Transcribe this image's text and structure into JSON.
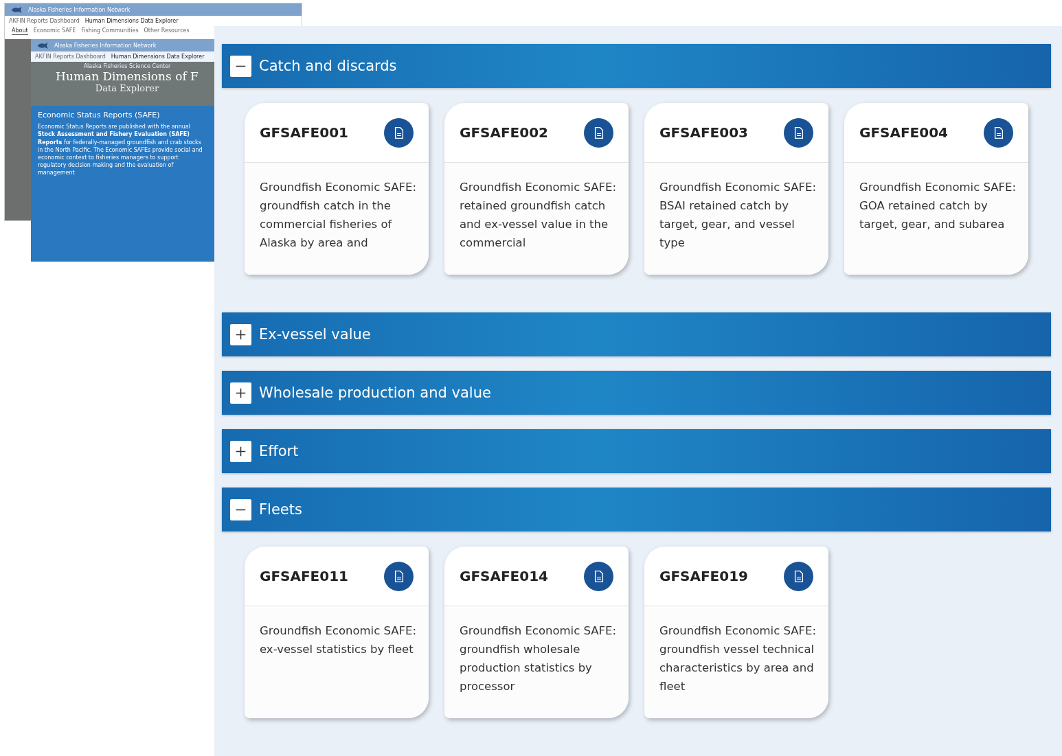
{
  "back_window": {
    "site_title": "Alaska Fisheries Information Network",
    "breadcrumb": [
      "AKFIN Reports Dashboard",
      "Human Dimensions Data Explorer"
    ],
    "nav": [
      {
        "label": "About",
        "selected": true
      },
      {
        "label": "Economic SAFE",
        "selected": false
      },
      {
        "label": "Fishing Communities",
        "selected": false
      },
      {
        "label": "Other Resources",
        "selected": false
      }
    ]
  },
  "front_window": {
    "site_title": "Alaska Fisheries Information Network",
    "breadcrumb": [
      "AKFIN Reports Dashboard",
      "Human Dimensions Data Explorer"
    ],
    "center_name": "Alaska Fisheries Science Center",
    "hero_title": "Human Dimensions of F",
    "hero_subtitle": "Data Explorer",
    "panel": {
      "title": "Economic Status Reports (SAFE)",
      "text": "Economic Status Reports are published with the annual **Stock Assessment and Fishery Evaluation (SAFE) Reports** for federally-managed groundfish and crab stocks in the North Pacific. The Economic SAFEs provide social and economic context to fisheries managers to support regulatory decision making and the evaluation of management"
    }
  },
  "sections": [
    {
      "title": "Catch and discards",
      "expanded": true,
      "cards": [
        {
          "code": "GFSAFE001",
          "description": "Groundfish Economic SAFE: groundfish catch in the commercial fisheries of Alaska by area and"
        },
        {
          "code": "GFSAFE002",
          "description": "Groundfish Economic SAFE: retained groundfish catch and ex-vessel value in the commercial"
        },
        {
          "code": "GFSAFE003",
          "description": "Groundfish Economic SAFE: BSAI retained catch by target, gear, and vessel type"
        },
        {
          "code": "GFSAFE004",
          "description": "Groundfish Economic SAFE: GOA retained catch by target, gear, and subarea"
        }
      ]
    },
    {
      "title": "Ex-vessel value",
      "expanded": false
    },
    {
      "title": "Wholesale production and value",
      "expanded": false
    },
    {
      "title": "Effort",
      "expanded": false
    },
    {
      "title": "Fleets",
      "expanded": true,
      "cards": [
        {
          "code": "GFSAFE011",
          "description": "Groundfish Economic SAFE: ex-vessel statistics by fleet"
        },
        {
          "code": "GFSAFE014",
          "description": "Groundfish Economic SAFE: groundfish wholesale production statistics by processor"
        },
        {
          "code": "GFSAFE019",
          "description": "Groundfish Economic SAFE: groundfish vessel technical characteristics by area and fleet"
        }
      ]
    }
  ]
}
